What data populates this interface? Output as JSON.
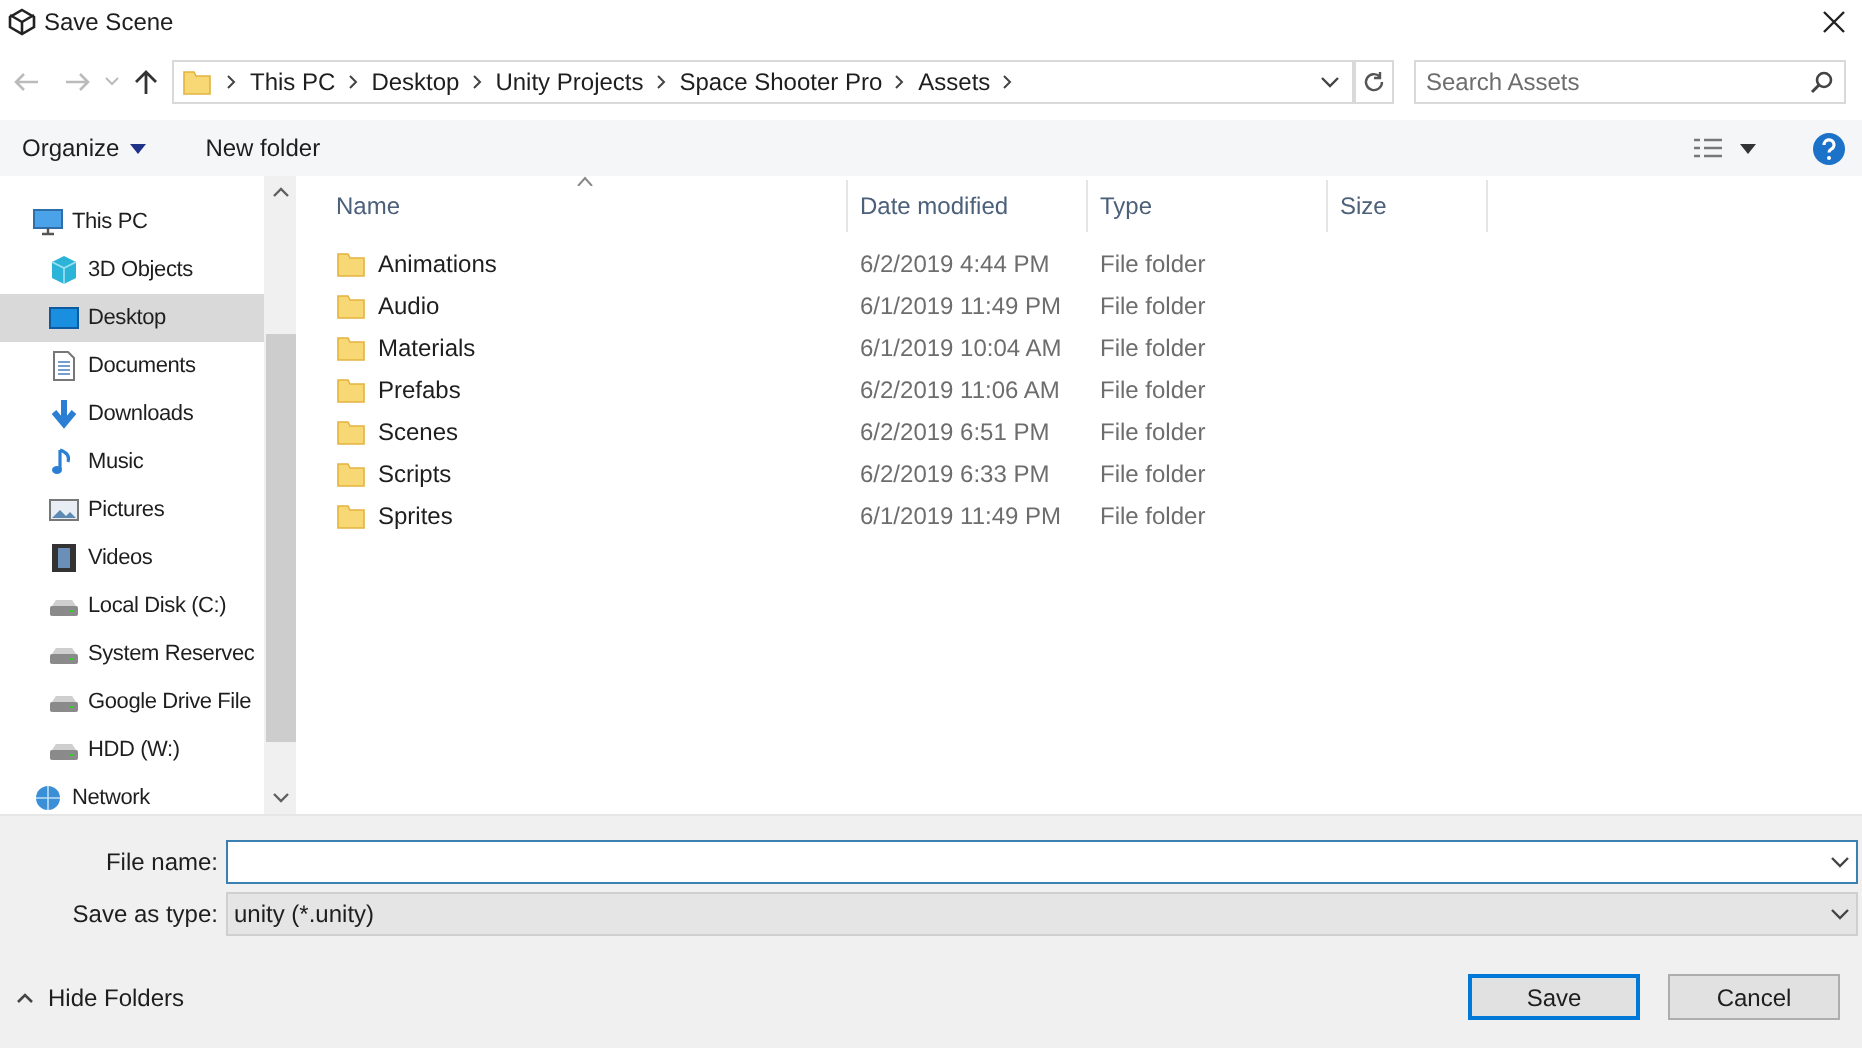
{
  "window": {
    "title": "Save Scene"
  },
  "address": {
    "crumbs": [
      "This PC",
      "Desktop",
      "Unity Projects",
      "Space Shooter Pro",
      "Assets"
    ]
  },
  "search": {
    "placeholder": "Search Assets"
  },
  "toolbar": {
    "organize": "Organize",
    "new_folder": "New folder"
  },
  "sidebar": {
    "items": [
      {
        "label": "This PC",
        "kind": "pc",
        "selected": false,
        "children": [
          {
            "label": "3D Objects",
            "kind": "cube",
            "selected": false
          },
          {
            "label": "Desktop",
            "kind": "desktop",
            "selected": true
          },
          {
            "label": "Documents",
            "kind": "doc",
            "selected": false
          },
          {
            "label": "Downloads",
            "kind": "download",
            "selected": false
          },
          {
            "label": "Music",
            "kind": "music",
            "selected": false
          },
          {
            "label": "Pictures",
            "kind": "pictures",
            "selected": false
          },
          {
            "label": "Videos",
            "kind": "videos",
            "selected": false
          },
          {
            "label": "Local Disk (C:)",
            "kind": "drive",
            "selected": false
          },
          {
            "label": "System Reservec",
            "kind": "drive",
            "selected": false
          },
          {
            "label": "Google Drive File",
            "kind": "drive",
            "selected": false
          },
          {
            "label": "HDD (W:)",
            "kind": "drive",
            "selected": false
          }
        ]
      },
      {
        "label": "Network",
        "kind": "network",
        "selected": false
      }
    ]
  },
  "table": {
    "columns": [
      "Name",
      "Date modified",
      "Type",
      "Size"
    ],
    "rows": [
      {
        "name": "Animations",
        "date": "6/2/2019 4:44 PM",
        "type": "File folder"
      },
      {
        "name": "Audio",
        "date": "6/1/2019 11:49 PM",
        "type": "File folder"
      },
      {
        "name": "Materials",
        "date": "6/1/2019 10:04 AM",
        "type": "File folder"
      },
      {
        "name": "Prefabs",
        "date": "6/2/2019 11:06 AM",
        "type": "File folder"
      },
      {
        "name": "Scenes",
        "date": "6/2/2019 6:51 PM",
        "type": "File folder"
      },
      {
        "name": "Scripts",
        "date": "6/2/2019 6:33 PM",
        "type": "File folder"
      },
      {
        "name": "Sprites",
        "date": "6/1/2019 11:49 PM",
        "type": "File folder"
      }
    ]
  },
  "form": {
    "file_name_label": "File name:",
    "type_label": "Save as type:",
    "type_value": "unity (*.unity)"
  },
  "hide_folders": "Hide Folders",
  "buttons": [
    "Save",
    "Cancel"
  ]
}
